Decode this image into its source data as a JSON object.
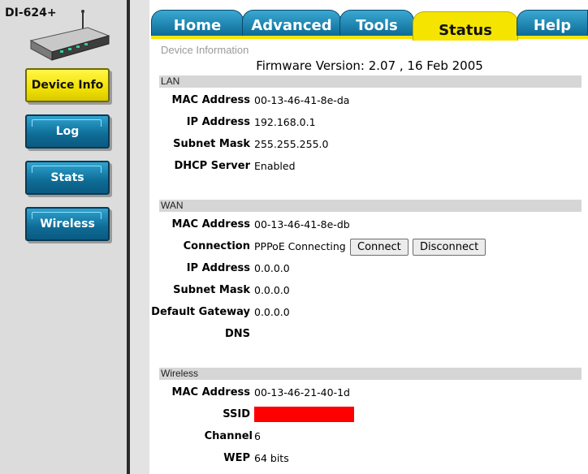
{
  "device": {
    "model": "DI-624+"
  },
  "sidebar": {
    "items": [
      {
        "label": "Device Info",
        "active": true
      },
      {
        "label": "Log",
        "active": false
      },
      {
        "label": "Stats",
        "active": false
      },
      {
        "label": "Wireless",
        "active": false
      }
    ]
  },
  "tabs": [
    {
      "label": "Home",
      "active": false
    },
    {
      "label": "Advanced",
      "active": false
    },
    {
      "label": "Tools",
      "active": false
    },
    {
      "label": "Status",
      "active": true
    },
    {
      "label": "Help",
      "active": false
    }
  ],
  "main": {
    "page_title": "Device Information",
    "firmware_label": "Firmware Version:",
    "firmware_value": "2.07 , 16 Feb 2005",
    "lan": {
      "title": "LAN",
      "rows": [
        {
          "label": "MAC Address",
          "value": "00-13-46-41-8e-da"
        },
        {
          "label": "IP Address",
          "value": "192.168.0.1"
        },
        {
          "label": "Subnet Mask",
          "value": "255.255.255.0"
        },
        {
          "label": "DHCP Server",
          "value": "Enabled"
        }
      ]
    },
    "wan": {
      "title": "WAN",
      "rows": [
        {
          "label": "MAC Address",
          "value": "00-13-46-41-8e-db"
        },
        {
          "label": "Connection",
          "value": "PPPoE Connecting"
        },
        {
          "label": "IP Address",
          "value": "0.0.0.0"
        },
        {
          "label": "Subnet Mask",
          "value": "0.0.0.0"
        },
        {
          "label": "Default Gateway",
          "value": "0.0.0.0"
        },
        {
          "label": "DNS",
          "value": ""
        }
      ],
      "connect_label": "Connect",
      "disconnect_label": "Disconnect"
    },
    "wireless": {
      "title": "Wireless",
      "rows": [
        {
          "label": "MAC Address",
          "value": "00-13-46-21-40-1d"
        },
        {
          "label": "SSID",
          "value": ""
        },
        {
          "label": "Channel",
          "value": "6"
        },
        {
          "label": "WEP",
          "value": "64 bits"
        }
      ]
    }
  },
  "colors": {
    "accent_yellow": "#f5e400",
    "tab_blue": "#0c6b96",
    "ssid_redaction": "#ff0000",
    "section_header": "#d6d6d6"
  }
}
